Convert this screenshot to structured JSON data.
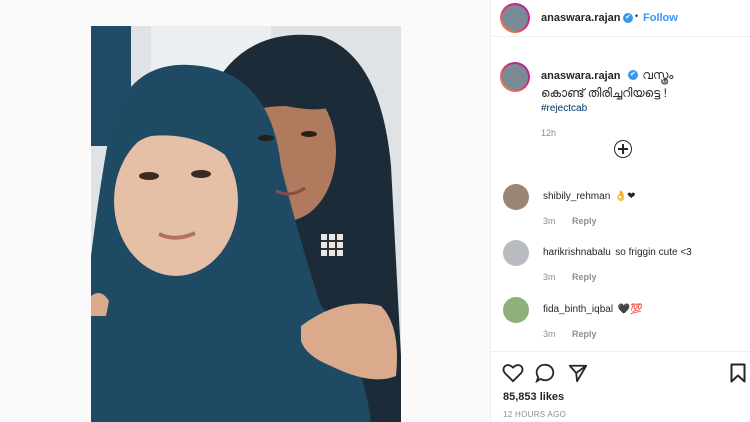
{
  "header": {
    "username": "anaswara.rajan",
    "verified_mark": "✔",
    "separator": "•",
    "follow_label": "Follow"
  },
  "caption": {
    "username": "anaswara.rajan",
    "text_line1": "വസ്ത്രം",
    "text_line2": "കൊണ്ട് തിരിച്ചറിയട്ടെ !",
    "hashtag": "#rejectcab",
    "time": "12h"
  },
  "comments": [
    {
      "username": "shibily_rehman",
      "text": "👌❤",
      "time": "3m",
      "reply_label": "Reply"
    },
    {
      "username": "harikrishnabalu",
      "text": "so friggin cute <3",
      "time": "3m",
      "reply_label": "Reply"
    },
    {
      "username": "fida_binth_iqbal",
      "text": "🖤💯",
      "time": "3m",
      "reply_label": "Reply"
    }
  ],
  "actions": {
    "likes": "85,853 likes",
    "timestamp": "12 HOURS AGO"
  },
  "icons": [
    "heart-icon",
    "comment-icon",
    "share-icon",
    "bookmark-icon",
    "load-more-icon",
    "verified-icon"
  ],
  "colors": {
    "link": "#3897f0",
    "hashtag": "#003569",
    "hijab": "#1f4a63"
  }
}
